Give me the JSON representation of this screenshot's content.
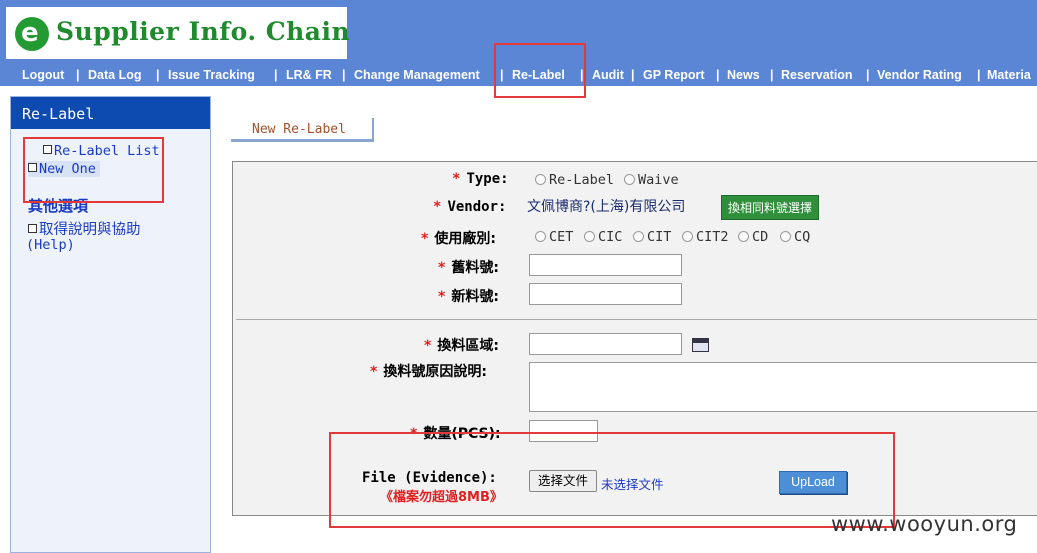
{
  "header": {
    "logo_glyph": "e",
    "logo_text": "Supplier Info. Chain",
    "nav": [
      "Logout",
      "Data Log",
      "Issue Tracking",
      "LR& FR",
      "Change Management",
      "Re-Label",
      "Audit",
      "GP Report",
      "News",
      "Reservation",
      "Vendor Rating",
      "Materia"
    ]
  },
  "sidebar": {
    "title": "Re-Label",
    "links": [
      "Re-Label List",
      "New One"
    ],
    "other_title": "其他選項",
    "help_line1": "取得說明與協助",
    "help_line2": "(Help)"
  },
  "tab": {
    "label": "New Re-Label"
  },
  "form": {
    "type_label": "Type:",
    "type_options": [
      "Re-Label",
      "Waive"
    ],
    "vendor_label": "Vendor:",
    "vendor_value": "文佩博商?(上海)有限公司",
    "vendor_button": "換相同料號選擇",
    "plant_label": "使用廠別:",
    "plant_options": [
      "CET",
      "CIC",
      "CIT",
      "CIT2",
      "CD",
      "CQ"
    ],
    "old_part_label": "舊料號:",
    "new_part_label": "新料號:",
    "area_label": "換料區域:",
    "reason_label": "換料號原因說明:",
    "qty_label": "數量(PCS):",
    "file_label": "File (Evidence):",
    "file_note": "《檔案勿超過8MB》",
    "choose_button": "选择文件",
    "no_file_text": "未选择文件",
    "upload_button": "UpLoad",
    "required_mark": "*"
  },
  "watermark": "www.wooyun.org",
  "colors": {
    "header_bg": "#5b86d6",
    "sidebar_head": "#0d4bb0",
    "highlight": "#e23a3a",
    "required": "#e02020"
  }
}
